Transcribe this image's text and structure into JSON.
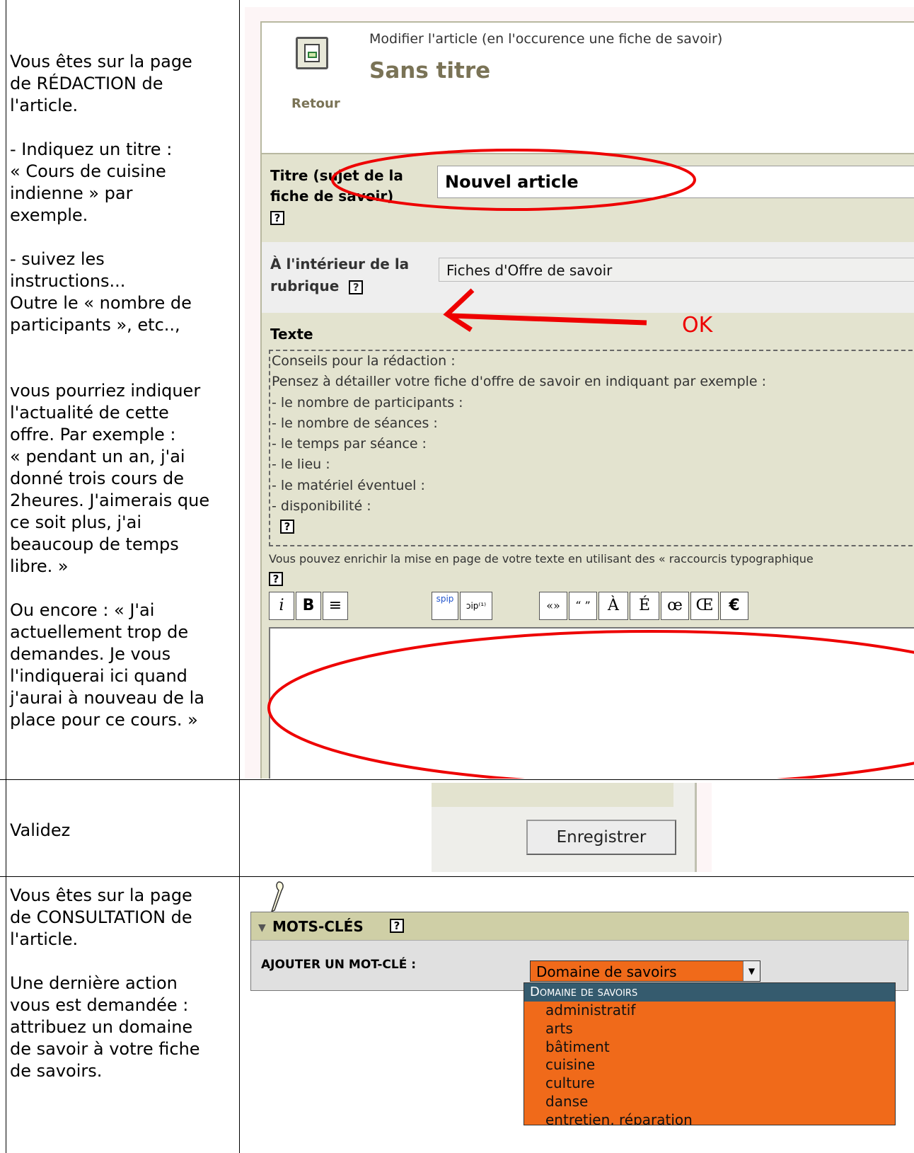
{
  "rows": [
    {
      "instruction": "Vous êtes sur la page\nde RÉDACTION de\nl'article.\n\n- Indiquez un titre :\n« Cours de cuisine\nindienne » par\nexemple.\n\n- suivez les\ninstructions...\nOutre le « nombre de\nparticipants », etc..,\n\n\nvous pourriez indiquer\nl'actualité de cette\noffre. Par exemple :\n« pendant un an, j'ai\ndonné trois cours de\n2heures. J'aimerais que\nce soit plus, j'ai\nbeaucoup de temps\nlibre. »\n\nOu encore : « J'ai\nactuellement trop de\ndemandes. Je vous\nl'indiquerai ici quand\nj'aurai à nouveau de la\nplace pour ce cours. »"
    },
    {
      "instruction": "Validez"
    },
    {
      "instruction": "Vous êtes sur la page\nde CONSULTATION de\nl'article.\n\nUne dernière action\nvous est demandée :\nattribuez un domaine\nde savoir à votre fiche\nde savoirs."
    }
  ],
  "editor": {
    "back_label": "Retour",
    "subtitle": "Modifier l'article (en l'occurence une fiche de savoir)",
    "title": "Sans titre",
    "title_field_label": "Titre (sujet de la fiche de savoir)",
    "title_field_value": "Nouvel article",
    "rubrique_label": "À l'intérieur de la rubrique",
    "rubrique_value": "Fiches d'Offre de savoir",
    "annotation_ok": "OK",
    "texte_label": "Texte",
    "conseils": [
      "Conseils pour la rédaction :",
      "Pensez à détailler votre fiche d'offre de savoir en indiquant par exemple :",
      "- le nombre de participants :",
      "- le nombre de séances :",
      "- le temps par séance :",
      "- le lieu :",
      "- le matériel éventuel :",
      "- disponibilité :"
    ],
    "enrich_hint": "Vous pouvez enrichir la mise en page de votre texte en utilisant des « raccourcis typographique",
    "help_glyph": "?",
    "toolbar": {
      "italic": "i",
      "bold": "B",
      "center": "≡",
      "spip_link": "spip",
      "spip_note": "ɔip⁽¹⁾",
      "quotes_fr": "«»",
      "quotes_en": "“ ”",
      "a_grave": "À",
      "e_acute": "É",
      "oe": "œ",
      "OE": "Œ",
      "euro": "€"
    }
  },
  "validate": {
    "save_label": "Enregistrer"
  },
  "keywords": {
    "section_title": "MOTS-CLÉS",
    "add_label": "AJOUTER UN MOT-CLÉ :",
    "select_value": "Domaine de savoirs",
    "group_header": "Domaine de savoirs",
    "options": [
      "administratif",
      "arts",
      "bâtiment",
      "cuisine",
      "culture",
      "danse",
      "entretien, réparation"
    ]
  },
  "colors": {
    "annotation_red": "#e00000",
    "select_orange": "#f06a1a",
    "header_khaki": "#cfcfa6",
    "label_olive": "#7a7356"
  }
}
